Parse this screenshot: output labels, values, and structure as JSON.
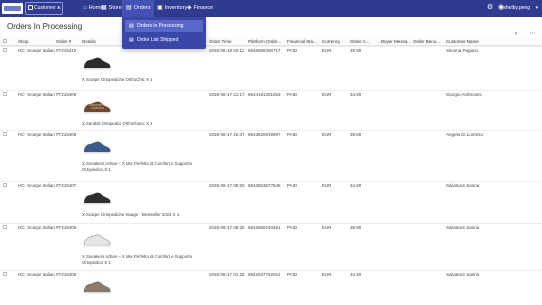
{
  "topbar": {
    "store_label": "Customer ...",
    "nav": [
      {
        "label": "Home",
        "icon": "home-icon",
        "glyph": "⌂"
      },
      {
        "label": "Stores",
        "icon": "store-icon",
        "glyph": "▦"
      },
      {
        "label": "Orders",
        "icon": "orders-icon",
        "glyph": "▤"
      },
      {
        "label": "Inventory",
        "icon": "inventory-icon",
        "glyph": "▣"
      },
      {
        "label": "Finance",
        "icon": "finance-icon",
        "glyph": "◈"
      }
    ],
    "user": "shelby.peng"
  },
  "orders_menu": {
    "items": [
      {
        "label": "Orders in Processing",
        "icon": "processing-icon"
      },
      {
        "label": "Order List Shipped",
        "icon": "shipped-icon"
      }
    ]
  },
  "page": {
    "title": "Orders In Processing"
  },
  "table": {
    "columns": [
      "Shop",
      "Order #",
      "Details",
      "Order Time",
      "Platform Order...",
      "Financial Sta...",
      "Currency",
      "Order A...",
      "Buyer Messa...",
      "Order Beno...",
      "Customer Name"
    ],
    "rows": [
      {
        "shop": "HC- Scarpe Italian",
        "order": "#T215410",
        "details": "X Scarpe Ortopediche OrthoChic X 1",
        "time": "2025-08-18 02:11",
        "platform": "6846688400717",
        "status": "PAID",
        "currency": "EUR",
        "amount": "39.90",
        "customer": "Simona Pagano",
        "shoe_color": "#2b2b2b"
      },
      {
        "shop": "HC- Scarpe Italian",
        "order": "#T215409",
        "details": "X Sandali Ortopedici OrthoGrace X 1",
        "time": "2025-08-17 21:17",
        "platform": "6844191251853",
        "status": "PAID",
        "currency": "EUR",
        "amount": "34.90",
        "customer": "Giorgio Ambrosini",
        "shoe_color": "#6b4a2e"
      },
      {
        "shop": "HC- Scarpe Italian",
        "order": "#T215408",
        "details": "X Sneakers Urban – X Mix Perfetto di Comfort e Supporto Ortopedico X 1",
        "time": "2025-08-17 16:37",
        "platform": "6843826919997",
        "status": "PAID",
        "currency": "EUR",
        "amount": "39.90",
        "customer": "Angela Di Lorenzo",
        "shoe_color": "#3b5a8c"
      },
      {
        "shop": "HC- Scarpe Italian",
        "order": "#T215407",
        "details": "X Scarpe Ortopediche Nuage - Bestseller 2024 X 1",
        "time": "2025-08-17 05:50",
        "platform": "6843553677645",
        "status": "PAID",
        "currency": "EUR",
        "amount": "34.90",
        "customer": "Salvatore Sanna",
        "shoe_color": "#2e2e30"
      },
      {
        "shop": "HC- Scarpe Italian",
        "order": "#T215406",
        "details": "X Sneakers Urban – X Mix Perfetto di Comfort e Supporto Ortopedico X 1",
        "time": "2025-08-17 05:35",
        "platform": "6842668240461",
        "status": "PAID",
        "currency": "EUR",
        "amount": "39.90",
        "customer": "Salvatore Sanna",
        "shoe_color": "#e6e6e6"
      },
      {
        "shop": "HC- Scarpe Italian",
        "order": "#T215405",
        "details": "",
        "time": "2025-08-17 01:25",
        "platform": "6842537752021",
        "status": "PAID",
        "currency": "EUR",
        "amount": "34.90",
        "customer": "Salvatore Sanna",
        "shoe_color": "#8a7a6a"
      }
    ]
  },
  "colors": {
    "topbar": "#2f3b8f",
    "dropdown": "#3a47a8"
  }
}
